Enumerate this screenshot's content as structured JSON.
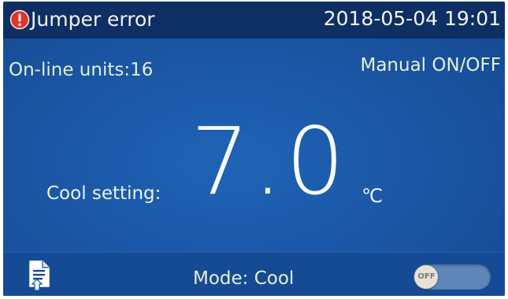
{
  "status": {
    "error_text": "Jumper error",
    "datetime": "2018-05-04 19:01",
    "error_icon": "alert-circle-icon"
  },
  "info": {
    "online_units_label": "On-line units:16",
    "control_mode": "Manual ON/OFF"
  },
  "setpoint": {
    "label": "Cool setting:",
    "value": "7.0",
    "unit": "℃"
  },
  "bottom": {
    "mode_label": "Mode: Cool",
    "toggle_label": "OFF",
    "toggle_on": false,
    "doc_icon": "document-icon"
  },
  "colors": {
    "background": "#1b57a6",
    "top_bar": "#0d2f63",
    "error_icon": "#e0352b",
    "toggle_track": "#5f86b8",
    "toggle_knob": "#e7e1d5"
  }
}
